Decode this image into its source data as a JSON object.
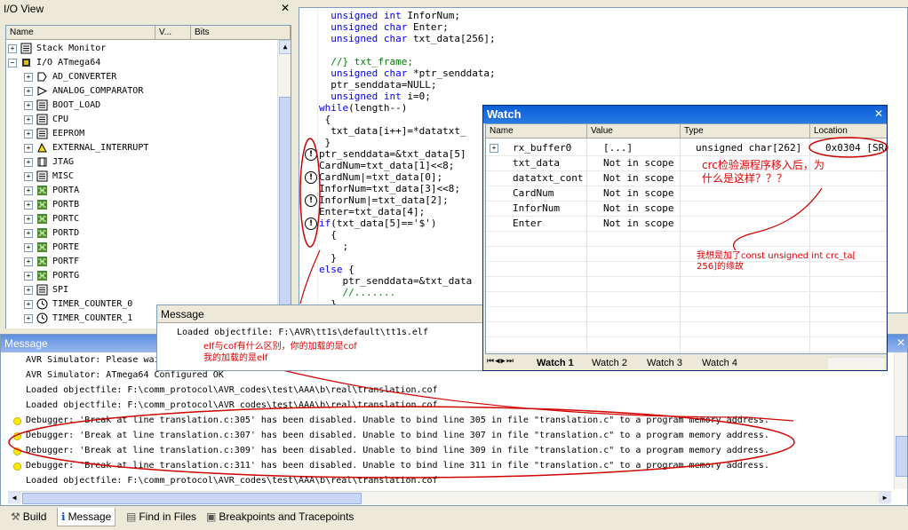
{
  "io_view": {
    "title": "I/O View",
    "columns": [
      "Name",
      "V...",
      "Bits"
    ],
    "items": [
      {
        "label": "Stack Monitor",
        "icon": "list-icon",
        "level": 0
      },
      {
        "label": "I/O ATmega64",
        "icon": "chip-icon",
        "level": 0
      },
      {
        "label": "AD_CONVERTER",
        "icon": "adc-icon",
        "level": 1
      },
      {
        "label": "ANALOG_COMPARATOR",
        "icon": "comparator-icon",
        "level": 1
      },
      {
        "label": "BOOT_LOAD",
        "icon": "list-icon",
        "level": 1
      },
      {
        "label": "CPU",
        "icon": "list-icon",
        "level": 1
      },
      {
        "label": "EEPROM",
        "icon": "list-icon",
        "level": 1
      },
      {
        "label": "EXTERNAL_INTERRUPT",
        "icon": "interrupt-icon",
        "level": 1
      },
      {
        "label": "JTAG",
        "icon": "jtag-icon",
        "level": 1
      },
      {
        "label": "MISC",
        "icon": "list-icon",
        "level": 1
      },
      {
        "label": "PORTA",
        "icon": "port-icon",
        "level": 1
      },
      {
        "label": "PORTB",
        "icon": "port-icon",
        "level": 1
      },
      {
        "label": "PORTC",
        "icon": "port-icon",
        "level": 1
      },
      {
        "label": "PORTD",
        "icon": "port-icon",
        "level": 1
      },
      {
        "label": "PORTE",
        "icon": "port-icon",
        "level": 1
      },
      {
        "label": "PORTF",
        "icon": "port-icon",
        "level": 1
      },
      {
        "label": "PORTG",
        "icon": "port-icon",
        "level": 1
      },
      {
        "label": "SPI",
        "icon": "list-icon",
        "level": 1
      },
      {
        "label": "TIMER_COUNTER_0",
        "icon": "clock-icon",
        "level": 1
      },
      {
        "label": "TIMER_COUNTER_1",
        "icon": "clock-icon",
        "level": 1
      }
    ]
  },
  "code": {
    "lines": [
      {
        "indent": "  ",
        "kw": "unsigned int",
        "text": " InforNum;"
      },
      {
        "indent": "  ",
        "kw": "unsigned char",
        "text": " Enter;"
      },
      {
        "indent": "  ",
        "kw": "unsigned char",
        "text": " txt_data[256];"
      },
      {
        "indent": "",
        "kw": "",
        "text": ""
      },
      {
        "indent": "  ",
        "kw": "",
        "text": "",
        "comment": "//} txt_frame;"
      },
      {
        "indent": "  ",
        "kw": "unsigned char",
        "text": " *ptr_senddata;"
      },
      {
        "indent": "  ",
        "kw": "",
        "text": "ptr_senddata=NULL;"
      },
      {
        "indent": "  ",
        "kw": "unsigned int",
        "text": " i=0;"
      },
      {
        "indent": "",
        "kw": "while",
        "text": "(length--)"
      },
      {
        "indent": " ",
        "kw": "",
        "text": "{"
      },
      {
        "indent": "  ",
        "kw": "",
        "text": "txt_data[i++]=*datatxt_"
      },
      {
        "indent": " ",
        "kw": "",
        "text": "}"
      },
      {
        "indent": "",
        "kw": "",
        "text": "ptr_senddata=&txt_data[5]"
      },
      {
        "indent": "",
        "kw": "",
        "text": "CardNum=txt_data[1]<<8;"
      },
      {
        "indent": "",
        "kw": "",
        "text": "CardNum|=txt_data[0];"
      },
      {
        "indent": "",
        "kw": "",
        "text": "InforNum=txt_data[3]<<8;"
      },
      {
        "indent": "",
        "kw": "",
        "text": "InforNum|=txt_data[2];"
      },
      {
        "indent": "",
        "kw": "",
        "text": "Enter=txt_data[4];"
      },
      {
        "indent": "",
        "kw": "if",
        "text": "(txt_data[5]=='$')"
      },
      {
        "indent": "  ",
        "kw": "",
        "text": "{"
      },
      {
        "indent": "    ",
        "kw": "",
        "text": ";"
      },
      {
        "indent": "  ",
        "kw": "",
        "text": "}"
      },
      {
        "indent": "",
        "kw": "else",
        "text": " {"
      },
      {
        "indent": "    ",
        "kw": "",
        "text": "ptr_senddata=&txt_data"
      },
      {
        "indent": "    ",
        "kw": "",
        "text": "",
        "comment": "//......."
      },
      {
        "indent": "  ",
        "kw": "",
        "text": "}"
      }
    ]
  },
  "watch": {
    "title": "Watch",
    "columns": [
      "Name",
      "Value",
      "Type",
      "Location"
    ],
    "rows": [
      {
        "name": "rx_buffer0",
        "value": "[...]",
        "type": "unsigned char[262]",
        "location": "0x0304 [SRA"
      },
      {
        "name": "txt_data",
        "value": "Not in scope",
        "type": "",
        "location": ""
      },
      {
        "name": "datatxt_cont",
        "value": "Not in scope",
        "type": "",
        "location": ""
      },
      {
        "name": "CardNum",
        "value": "Not in scope",
        "type": "",
        "location": ""
      },
      {
        "name": "InforNum",
        "value": "Not in scope",
        "type": "",
        "location": ""
      },
      {
        "name": "Enter",
        "value": "Not in scope",
        "type": "",
        "location": ""
      }
    ],
    "tabs": [
      "Watch 1",
      "Watch 2",
      "Watch 3",
      "Watch 4"
    ],
    "annotation_1": "crc检验源程序移入后，为\n什么是这样？？？",
    "annotation_2": "我想是加了const unsigned int crc_ta[\n256]的缘故"
  },
  "message_popup": {
    "title": "Message",
    "line": "Loaded objectfile: F:\\AVR\\tt1s\\default\\tt1s.elf",
    "annotation": "elf与cof有什么区别，你的加载的是cof\n我的加载的是elf"
  },
  "message": {
    "title": "Message",
    "lines": [
      {
        "dot": false,
        "text": "AVR Simulator: Please wai"
      },
      {
        "dot": false,
        "text": "AVR Simulator: ATmega64 Configured OK"
      },
      {
        "dot": false,
        "text": "Loaded objectfile: F:\\comm_protocol\\AVR_codes\\test\\AAA\\b\\real\\translation.cof"
      },
      {
        "dot": false,
        "text": "Loaded objectfile: F:\\comm_protocol\\AVR_codes\\test\\AAA\\b\\real\\translation.cof"
      },
      {
        "dot": true,
        "text": "Debugger: 'Break at line translation.c:305' has been disabled. Unable to bind line 305 in file \"translation.c\" to a program memory address."
      },
      {
        "dot": true,
        "text": "Debugger: 'Break at line translation.c:307' has been disabled. Unable to bind line 307 in file \"translation.c\" to a program memory address."
      },
      {
        "dot": true,
        "text": "Debugger: 'Break at line translation.c:309' has been disabled. Unable to bind line 309 in file \"translation.c\" to a program memory address."
      },
      {
        "dot": true,
        "text": "Debugger: 'Break at line translation.c:311' has been disabled. Unable to bind line 311 in file \"translation.c\" to a program memory address."
      },
      {
        "dot": false,
        "text": "Loaded objectfile: F:\\comm_protocol\\AVR_codes\\test\\AAA\\b\\real\\translation.cof"
      }
    ]
  },
  "bottom_tabs": [
    {
      "label": "Build",
      "icon": "build-icon"
    },
    {
      "label": "Message",
      "icon": "info-icon"
    },
    {
      "label": "Find in Files",
      "icon": "find-icon"
    },
    {
      "label": "Breakpoints and Tracepoints",
      "icon": "breakpoint-icon"
    }
  ],
  "colors": {
    "annotation": "#e00000",
    "title_active": "#0a5fd8",
    "keyword": "#0000ff",
    "comment": "#008000"
  }
}
